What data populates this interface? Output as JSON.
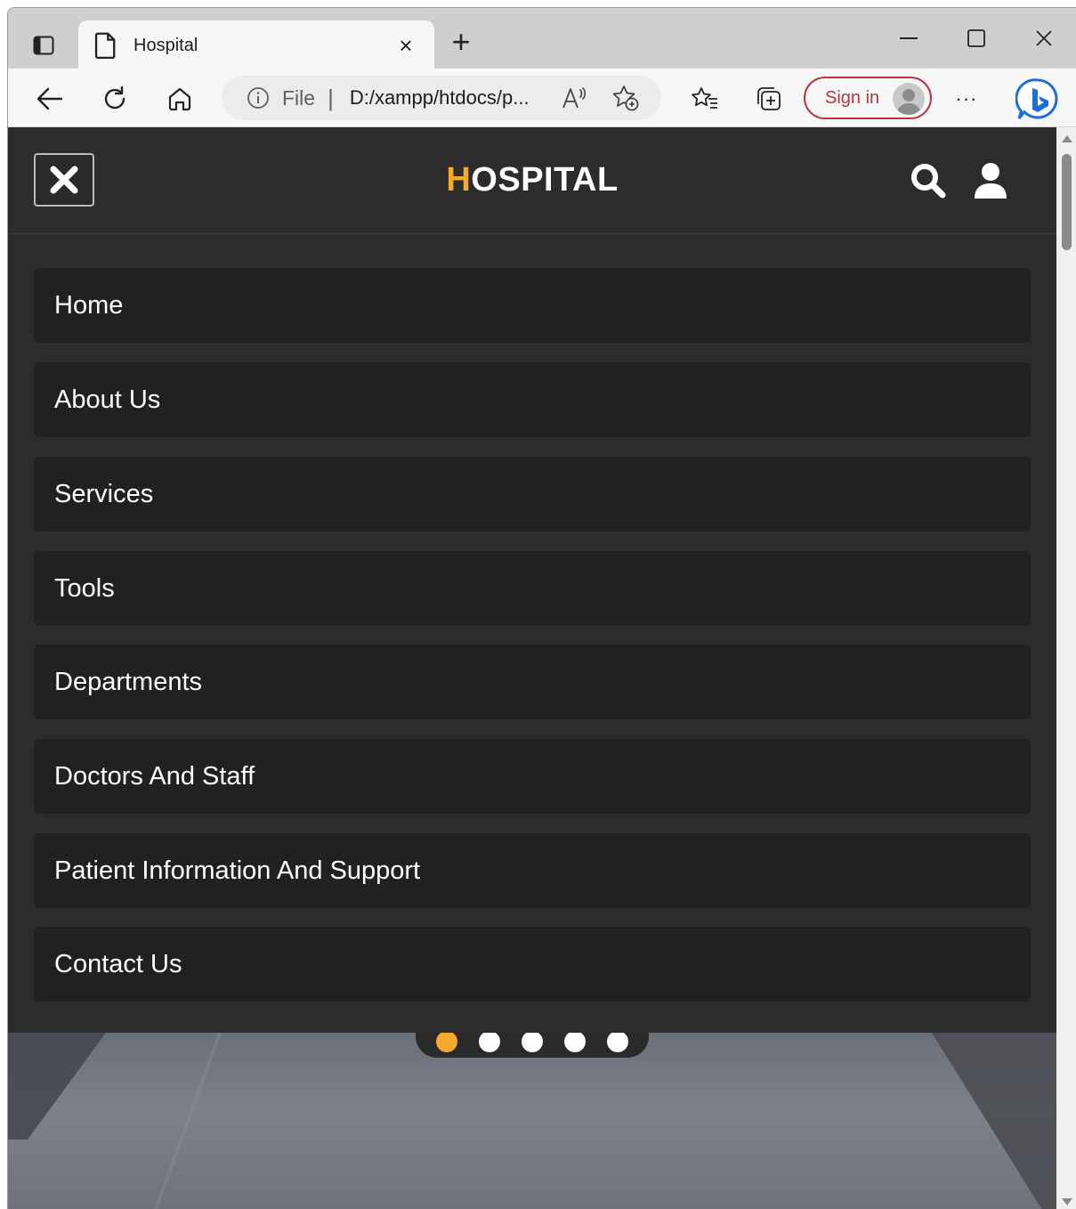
{
  "browser": {
    "tab": {
      "title": "Hospital",
      "close_glyph": "×"
    },
    "new_tab_glyph": "+",
    "address": {
      "file_label": "File",
      "separator": "|",
      "url": "D:/xampp/htdocs/p..."
    },
    "signin_label": "Sign in",
    "more_glyph": "···"
  },
  "site": {
    "brand_first": "H",
    "brand_rest": "OSPITAL",
    "accent_color": "#f6a92b",
    "menu": [
      {
        "label": "Home"
      },
      {
        "label": "About Us"
      },
      {
        "label": "Services"
      },
      {
        "label": "Tools"
      },
      {
        "label": "Departments"
      },
      {
        "label": "Doctors And Staff"
      },
      {
        "label": "Patient Information And Support"
      },
      {
        "label": "Contact Us"
      }
    ],
    "carousel": {
      "slides": 5,
      "active_index": 0
    }
  }
}
